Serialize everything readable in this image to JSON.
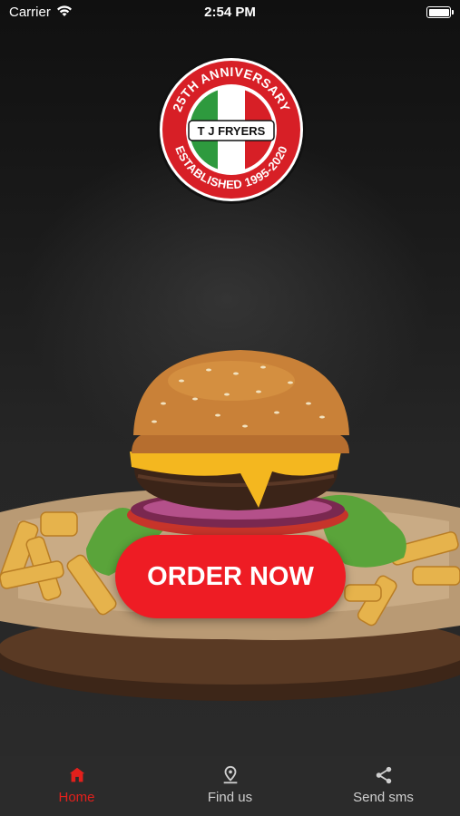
{
  "status_bar": {
    "carrier": "Carrier",
    "time": "2:54 PM"
  },
  "logo": {
    "ring_top": "25TH ANNIVERSARY",
    "ring_bottom": "ESTABLISHED 1995-2020",
    "center": "T J FRYERS"
  },
  "order_button": {
    "label": "ORDER NOW"
  },
  "tabs": [
    {
      "label": "Home",
      "icon": "home-icon",
      "active": true
    },
    {
      "label": "Find us",
      "icon": "map-pin-icon",
      "active": false
    },
    {
      "label": "Send sms",
      "icon": "share-icon",
      "active": false
    }
  ],
  "colors": {
    "accent": "#ee1c24",
    "tab_active": "#e3201c",
    "tab_bar": "#2b2b2b"
  }
}
